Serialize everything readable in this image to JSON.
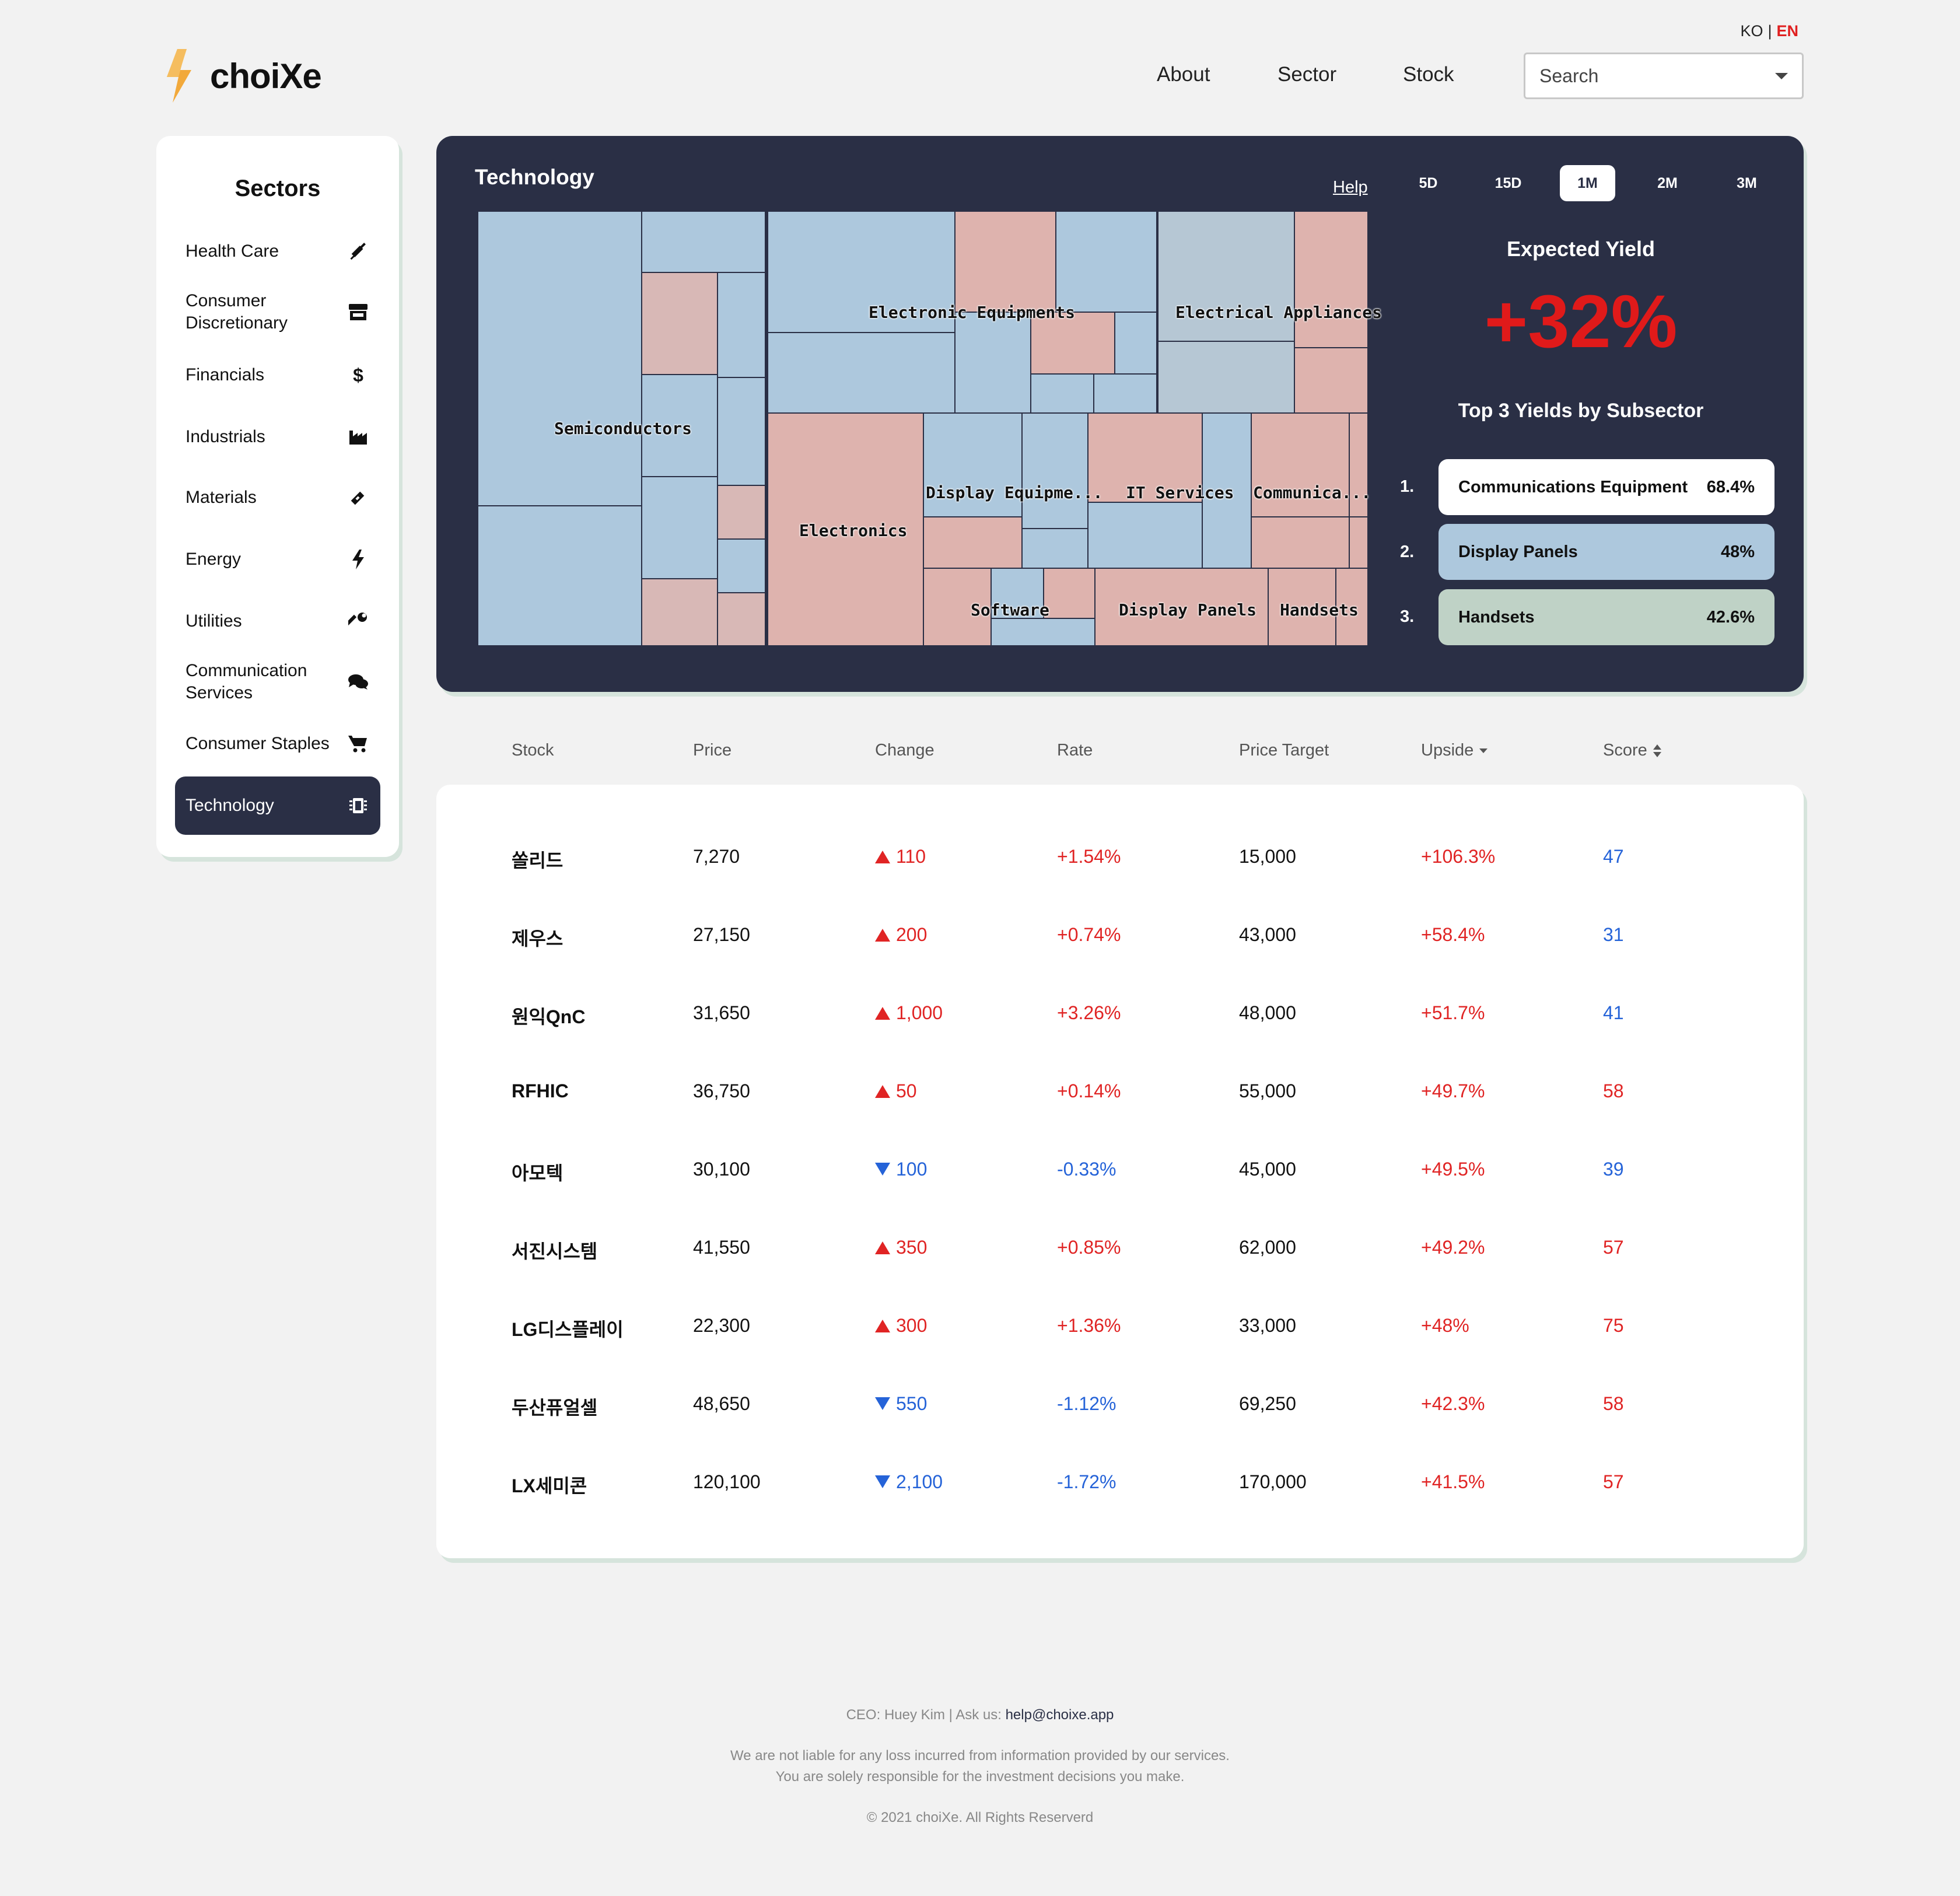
{
  "colors": {
    "accent": "#e02020",
    "panel": "#2a2f45",
    "up": "#e02424",
    "down": "#2563d8",
    "logo": "#f2a93b"
  },
  "lang": {
    "ko": "KO",
    "en": "EN"
  },
  "brand": {
    "name": "choiXe"
  },
  "nav": {
    "about": "About",
    "sector": "Sector",
    "stock": "Stock"
  },
  "search": {
    "placeholder": "Search"
  },
  "sidebar": {
    "title": "Sectors",
    "items": [
      {
        "label": "Health Care",
        "icon": "syringe-icon"
      },
      {
        "label": "Consumer Discretionary",
        "icon": "store-icon"
      },
      {
        "label": "Financials",
        "icon": "dollar-icon"
      },
      {
        "label": "Industrials",
        "icon": "factory-icon"
      },
      {
        "label": "Materials",
        "icon": "pencil-icon"
      },
      {
        "label": "Energy",
        "icon": "bolt-icon"
      },
      {
        "label": "Utilities",
        "icon": "wrench-icon"
      },
      {
        "label": "Communication Services",
        "icon": "chat-icon"
      },
      {
        "label": "Consumer Staples",
        "icon": "cart-icon"
      },
      {
        "label": "Technology",
        "icon": "chip-icon",
        "active": true
      }
    ]
  },
  "panel": {
    "title": "Technology",
    "help": "Help",
    "periods": [
      "5D",
      "15D",
      "1M",
      "2M",
      "3M"
    ],
    "active_period": "1M",
    "treemap_labels": {
      "semiconductors": "Semiconductors",
      "electronic_equipments": "Electronic Equipments",
      "electrical_appliances": "Electrical Appliances",
      "electronics": "Electronics",
      "display_equipment": "Display Equipme...",
      "it_services": "IT Services",
      "communications": "Communica...",
      "software": "Software",
      "display_panels": "Display Panels",
      "handsets": "Handsets"
    },
    "expected_yield_title": "Expected Yield",
    "expected_yield": "+32%",
    "top3_title": "Top 3 Yields by Subsector",
    "top3": [
      {
        "rank": "1.",
        "name": "Communications Equipment",
        "pct": "68.4%",
        "color": "#ffffff"
      },
      {
        "rank": "2.",
        "name": "Display Panels",
        "pct": "48%",
        "color": "#adc8dd"
      },
      {
        "rank": "3.",
        "name": "Handsets",
        "pct": "42.6%",
        "color": "#bfd2c6"
      }
    ]
  },
  "table": {
    "headers": {
      "stock": "Stock",
      "price": "Price",
      "change": "Change",
      "rate": "Rate",
      "target": "Price Target",
      "upside": "Upside",
      "score": "Score"
    },
    "rows": [
      {
        "stock": "쏠리드",
        "price": "7,270",
        "dir": "up",
        "change": "110",
        "rate": "+1.54%",
        "target": "15,000",
        "upside": "+106.3%",
        "score": "47",
        "score_color": "blue"
      },
      {
        "stock": "제우스",
        "price": "27,150",
        "dir": "up",
        "change": "200",
        "rate": "+0.74%",
        "target": "43,000",
        "upside": "+58.4%",
        "score": "31",
        "score_color": "blue"
      },
      {
        "stock": "원익QnC",
        "price": "31,650",
        "dir": "up",
        "change": "1,000",
        "rate": "+3.26%",
        "target": "48,000",
        "upside": "+51.7%",
        "score": "41",
        "score_color": "blue"
      },
      {
        "stock": "RFHIC",
        "price": "36,750",
        "dir": "up",
        "change": "50",
        "rate": "+0.14%",
        "target": "55,000",
        "upside": "+49.7%",
        "score": "58",
        "score_color": "red"
      },
      {
        "stock": "아모텍",
        "price": "30,100",
        "dir": "down",
        "change": "100",
        "rate": "-0.33%",
        "target": "45,000",
        "upside": "+49.5%",
        "score": "39",
        "score_color": "blue"
      },
      {
        "stock": "서진시스템",
        "price": "41,550",
        "dir": "up",
        "change": "350",
        "rate": "+0.85%",
        "target": "62,000",
        "upside": "+49.2%",
        "score": "57",
        "score_color": "red"
      },
      {
        "stock": "LG디스플레이",
        "price": "22,300",
        "dir": "up",
        "change": "300",
        "rate": "+1.36%",
        "target": "33,000",
        "upside": "+48%",
        "score": "75",
        "score_color": "red"
      },
      {
        "stock": "두산퓨얼셀",
        "price": "48,650",
        "dir": "down",
        "change": "550",
        "rate": "-1.12%",
        "target": "69,250",
        "upside": "+42.3%",
        "score": "58",
        "score_color": "red"
      },
      {
        "stock": "LX세미콘",
        "price": "120,100",
        "dir": "down",
        "change": "2,100",
        "rate": "-1.72%",
        "target": "170,000",
        "upside": "+41.5%",
        "score": "57",
        "score_color": "red"
      }
    ]
  },
  "footer": {
    "ceo": "CEO: Huey Kim | Ask us: ",
    "email": "help@choixe.app",
    "disclaimer1": "We are not liable for any loss incurred from information provided by our services.",
    "disclaimer2": "You are solely responsible for the investment decisions you make.",
    "copyright": "© 2021 choiXe. All Rights Reserverd"
  }
}
